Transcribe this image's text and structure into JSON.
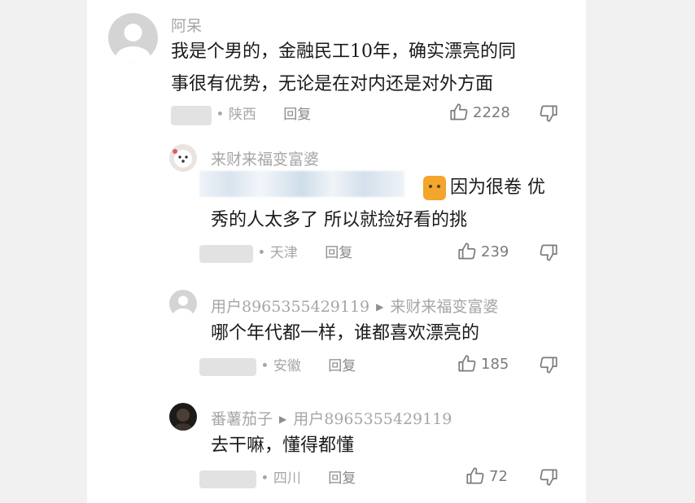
{
  "comments": [
    {
      "user": "阿呆",
      "text_lines": [
        "我是个男的，金融民工10年，确实漂亮的同",
        "事很有优势，无论是在对内还是对外方面"
      ],
      "location": "• 陕西",
      "reply_label": "回复",
      "likes": "2228"
    },
    {
      "user": "来财来福变富婆",
      "text_lines": [
        "因为很卷 优",
        "秀的人太多了 所以就捡好看的挑"
      ],
      "location": "• 天津",
      "reply_label": "回复",
      "likes": "239"
    },
    {
      "user": "用户8965355429119",
      "reply_to": "来财来福变富婆",
      "text_lines": [
        "哪个年代都一样，谁都喜欢漂亮的"
      ],
      "location": "• 安徽",
      "reply_label": "回复",
      "likes": "185"
    },
    {
      "user": "番薯茄子",
      "reply_to": "用户8965355429119",
      "text_lines": [
        "去干嘛，懂得都懂"
      ],
      "location": "• 四川",
      "reply_label": "回复",
      "likes": "72"
    }
  ],
  "icons": {
    "like": "thumbs-up-icon",
    "dislike": "thumbs-down-icon",
    "reply_arrow": "triangle-right-icon"
  },
  "colors": {
    "background": "#f1f1f1",
    "panel": "#ffffff",
    "text": "#1a1a1a",
    "muted": "#a6a6a6"
  }
}
